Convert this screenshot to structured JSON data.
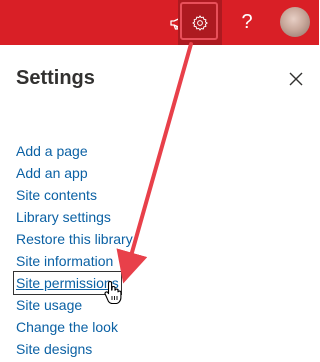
{
  "header": {
    "icons": {
      "megaphone": "megaphone-icon",
      "settings": "gear-icon",
      "help": "question-icon",
      "avatar": "avatar"
    },
    "help_label": "?",
    "colors": {
      "bar": "#d91f26",
      "active": "#ad1a20",
      "highlight": "#e8505a"
    }
  },
  "panel": {
    "title": "Settings",
    "close_icon": "close-icon",
    "items": [
      {
        "label": "Add a page"
      },
      {
        "label": "Add an app"
      },
      {
        "label": "Site contents"
      },
      {
        "label": "Library settings"
      },
      {
        "label": "Restore this library"
      },
      {
        "label": "Site information"
      },
      {
        "label": "Site permissions",
        "focused": true
      },
      {
        "label": "Site usage"
      },
      {
        "label": "Change the look"
      },
      {
        "label": "Site designs"
      }
    ],
    "link_color": "#0b61a4"
  },
  "annotation": {
    "arrow_color": "#e8404a"
  }
}
